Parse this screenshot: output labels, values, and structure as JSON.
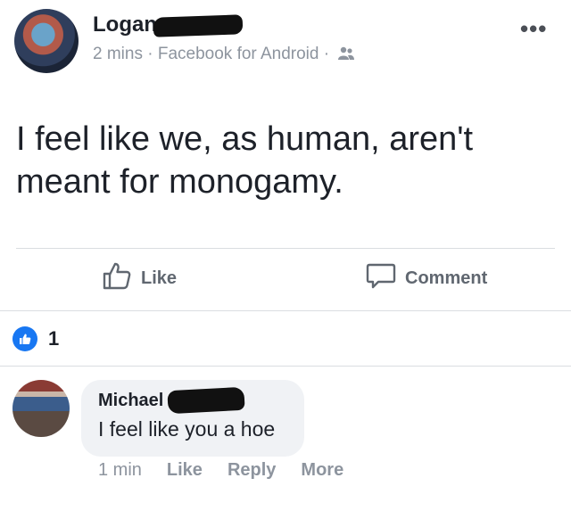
{
  "post": {
    "author": "Logan",
    "time": "2 mins",
    "separator": "·",
    "source": "Facebook for Android",
    "audience_icon": "friends-icon",
    "more_icon": "more-dots-icon",
    "text": "I feel like we, as human, aren't meant for monogamy."
  },
  "actions": {
    "like_label": "Like",
    "comment_label": "Comment",
    "like_icon": "thumbs-up-icon",
    "comment_icon": "comment-bubble-icon"
  },
  "reactions": {
    "count": "1",
    "icon": "like-reaction-icon",
    "color": "#1877f2"
  },
  "comment": {
    "author": "Michael",
    "text": "I feel like you a hoe",
    "time": "1 min",
    "like_label": "Like",
    "reply_label": "Reply",
    "more_label": "More"
  },
  "colors": {
    "text": "#1d2129",
    "secondary": "#8d949e",
    "action": "#606770",
    "divider": "#dadde1",
    "bubble": "#f0f2f5"
  }
}
